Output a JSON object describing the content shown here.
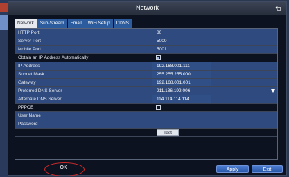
{
  "window": {
    "title": "Network"
  },
  "tabs": [
    {
      "label": "Network",
      "active": true
    },
    {
      "label": "Sub-Stream",
      "active": false
    },
    {
      "label": "Email",
      "active": false
    },
    {
      "label": "WiFi Setup",
      "active": false
    },
    {
      "label": "DDNS",
      "active": false
    }
  ],
  "settings": {
    "http_port": {
      "label": "HTTP Port",
      "value": "80"
    },
    "server_port": {
      "label": "Server Port",
      "value": "5000"
    },
    "mobile_port": {
      "label": "Mobile Port",
      "value": "5001"
    },
    "auto_ip": {
      "label": "Obtain an IP Address Automatically",
      "checked": true
    },
    "ip_address": {
      "label": "IP Address",
      "value": "192.168.001.111"
    },
    "subnet_mask": {
      "label": "Subnet Mask",
      "value": "255.255.255.000"
    },
    "gateway": {
      "label": "Gateway",
      "value": "192.168.001.001"
    },
    "preferred_dns": {
      "label": "Preferred DNS Server",
      "value": "211.136.192.006"
    },
    "alternate_dns": {
      "label": "Alternate DNS Server",
      "value": "114.114.114.114"
    },
    "pppoe": {
      "label": "PPPOE",
      "checked": false
    },
    "user_name": {
      "label": "User Name",
      "value": ""
    },
    "password": {
      "label": "Password",
      "value": ""
    }
  },
  "buttons": {
    "test": "Test",
    "ok": "OK",
    "apply": "Apply",
    "exit": "Exit"
  },
  "colors": {
    "row_blue": "#2e4a7e",
    "tab_blue": "#2d5c9e",
    "annotation_red": "#d12a2a"
  },
  "icons": {
    "back": "back-arrow-icon",
    "dropdown": "dropdown-arrow-icon"
  }
}
